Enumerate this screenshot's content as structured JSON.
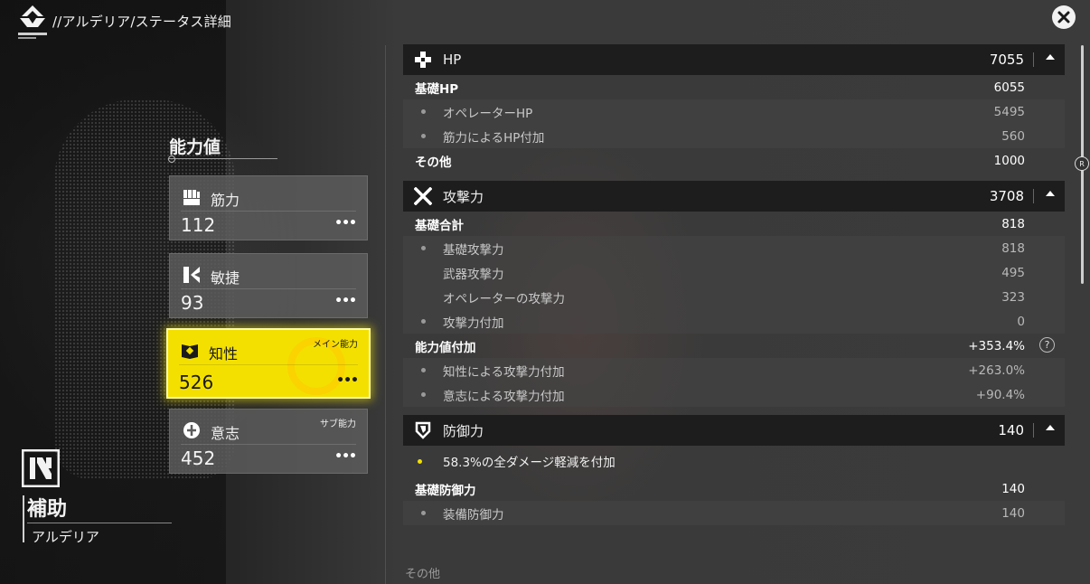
{
  "header": {
    "breadcrumb": "//アルデリア/ステータス詳細"
  },
  "stats_panel": {
    "title": "能力値",
    "cards": [
      {
        "name": "筋力",
        "value": "112",
        "tag": "",
        "icon": "fist-icon"
      },
      {
        "name": "敏捷",
        "value": "93",
        "tag": "",
        "icon": "agility-icon"
      },
      {
        "name": "知性",
        "value": "526",
        "tag": "メイン能力",
        "icon": "intellect-book-icon",
        "active": true
      },
      {
        "name": "意志",
        "value": "452",
        "tag": "サブ能力",
        "icon": "will-icon"
      }
    ],
    "more_label": "•••"
  },
  "role": {
    "name": "補助",
    "character": "アルデリア",
    "icon": "support-role-icon"
  },
  "sections": {
    "hp": {
      "name": "HP",
      "value": "7055",
      "rows": [
        {
          "type": "main",
          "label": "基礎HP",
          "value": "6055"
        },
        {
          "type": "sub",
          "label": "オペレーターHP",
          "value": "5495",
          "bullet": true
        },
        {
          "type": "sub",
          "label": "筋力によるHP付加",
          "value": "560",
          "bullet": true
        },
        {
          "type": "main",
          "label": "その他",
          "value": "1000"
        }
      ]
    },
    "atk": {
      "name": "攻撃力",
      "value": "3708",
      "rows": [
        {
          "type": "main",
          "label": "基礎合計",
          "value": "818"
        },
        {
          "type": "sub",
          "label": "基礎攻撃力",
          "value": "818",
          "bullet": true
        },
        {
          "type": "sub",
          "label": "武器攻撃力",
          "value": "495",
          "bullet": false
        },
        {
          "type": "sub",
          "label": "オペレーターの攻撃力",
          "value": "323",
          "bullet": false
        },
        {
          "type": "sub",
          "label": "攻撃力付加",
          "value": "0",
          "bullet": true
        },
        {
          "type": "main",
          "label": "能力値付加",
          "value": "+353.4%",
          "help": "?"
        },
        {
          "type": "sub",
          "label": "知性による攻撃力付加",
          "value": "+263.0%",
          "bullet": true
        },
        {
          "type": "sub",
          "label": "意志による攻撃力付加",
          "value": "+90.4%",
          "bullet": true
        }
      ]
    },
    "def": {
      "name": "防御力",
      "value": "140",
      "note": "58.3%の全ダメージ軽減を付加",
      "rows": [
        {
          "type": "main",
          "label": "基礎防御力",
          "value": "140"
        },
        {
          "type": "sub",
          "label": "装備防御力",
          "value": "140",
          "bullet": true
        }
      ]
    }
  },
  "cut_label": "その他",
  "scroll_knob_label": "R",
  "colors": {
    "accent": "#f3e000",
    "header_bg": "#1d1d1d",
    "row_sub_bg": "#464646"
  }
}
